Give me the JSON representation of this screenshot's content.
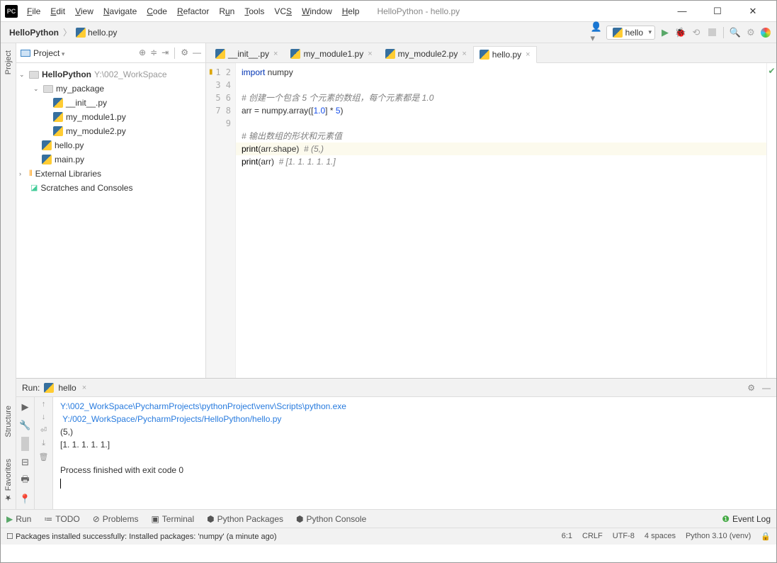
{
  "title": "HelloPython - hello.py",
  "menu": [
    "File",
    "Edit",
    "View",
    "Navigate",
    "Code",
    "Refactor",
    "Run",
    "Tools",
    "VCS",
    "Window",
    "Help"
  ],
  "breadcrumb": {
    "project": "HelloPython",
    "file": "hello.py"
  },
  "run_config": "hello",
  "project_label": "Project",
  "tree": {
    "root": "HelloPython",
    "root_path": "Y:\\002_WorkSpace",
    "pkg": "my_package",
    "files_pkg": [
      "__init__.py",
      "my_module1.py",
      "my_module2.py"
    ],
    "files_root": [
      "hello.py",
      "main.py"
    ],
    "ext_lib": "External Libraries",
    "scratch": "Scratches and Consoles"
  },
  "tabs": [
    "__init__.py",
    "my_module1.py",
    "my_module2.py",
    "hello.py"
  ],
  "active_tab": 3,
  "code": {
    "l1a": "import",
    "l1b": " numpy",
    "l3": "# 创建一个包含 5 个元素的数组，每个元素都是 1.0",
    "l4a": "arr = numpy.array([",
    "l4b": "1.0",
    "l4c": "] * ",
    "l4d": "5",
    "l4e": ")",
    "l6": "# 输出数组的形状和元素值",
    "l7a": "print",
    "l7b": "(arr.shape)  ",
    "l7c": "# (5,)",
    "l8a": "print",
    "l8b": "(arr)  ",
    "l8c": "# [1. 1. 1. 1. 1.]"
  },
  "run_tab_label": "Run:",
  "run_tab_name": "hello",
  "console": {
    "l1": "Y:\\002_WorkSpace\\PycharmProjects\\pythonProject\\venv\\Scripts\\python.exe",
    "l2": " Y:/002_WorkSpace/PycharmProjects/HelloPython/hello.py",
    "l3": "(5,)",
    "l4": "[1. 1. 1. 1. 1.]",
    "l5": "",
    "l6": "Process finished with exit code 0"
  },
  "bottom_tabs": {
    "run": "Run",
    "todo": "TODO",
    "problems": "Problems",
    "terminal": "Terminal",
    "pypkg": "Python Packages",
    "pyconsole": "Python Console",
    "eventlog": "Event Log"
  },
  "status_msg": "Packages installed successfully: Installed packages: 'numpy' (a minute ago)",
  "status": {
    "pos": "6:1",
    "eol": "CRLF",
    "enc": "UTF-8",
    "indent": "4 spaces",
    "interp": "Python 3.10 (venv)"
  },
  "side_tabs": {
    "project": "Project",
    "structure": "Structure",
    "favorites": "Favorites"
  }
}
